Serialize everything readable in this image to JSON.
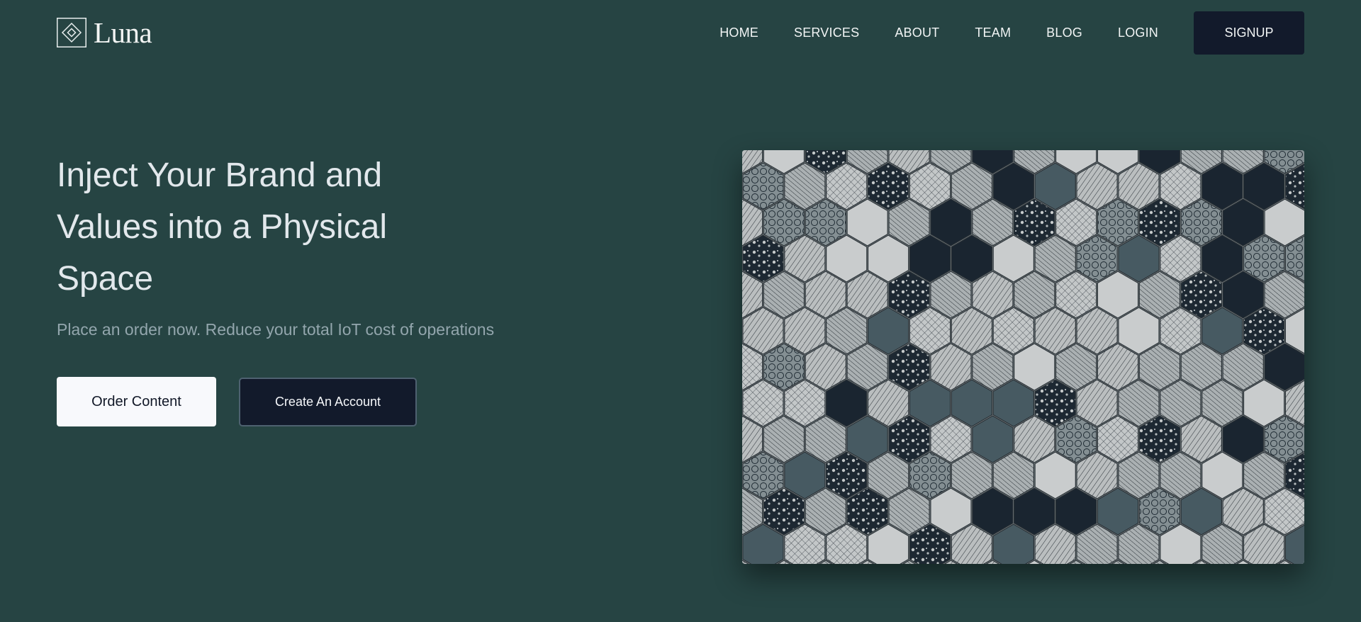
{
  "brand": {
    "name": "Luna",
    "logo_icon": "diamond-in-square-icon"
  },
  "nav": {
    "items": [
      {
        "label": "HOME"
      },
      {
        "label": "SERVICES"
      },
      {
        "label": "ABOUT"
      },
      {
        "label": "TEAM"
      },
      {
        "label": "BLOG"
      },
      {
        "label": "LOGIN"
      }
    ],
    "signup_label": "SIGNUP"
  },
  "hero": {
    "title": "Inject Your Brand and Values into a Physical Space",
    "subtitle": "Place an order now. Reduce your total IoT cost of operations",
    "primary_button": "Order Content",
    "secondary_button": "Create An Account",
    "image_subject": "hexagonal-patterned-tile-floor"
  },
  "colors": {
    "background": "#264443",
    "dark_button": "#121a2b",
    "light_button": "#f8f9fc",
    "subtitle": "#93a6ad"
  }
}
